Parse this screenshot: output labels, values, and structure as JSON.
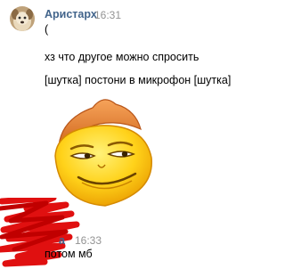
{
  "messages": [
    {
      "sender": "Аристарх",
      "time": "16:31",
      "lines": [
        "(",
        "хз что другое можно спросить",
        "[шутка] постони в микрофон [шутка]"
      ],
      "attachment": "smiling-emoji-sticker"
    },
    {
      "sender_visible": "а",
      "time": "16:33",
      "lines": [
        "потом мб"
      ]
    }
  ],
  "colors": {
    "sender": "#42648b",
    "time": "#939393",
    "redaction": "#e01010"
  }
}
